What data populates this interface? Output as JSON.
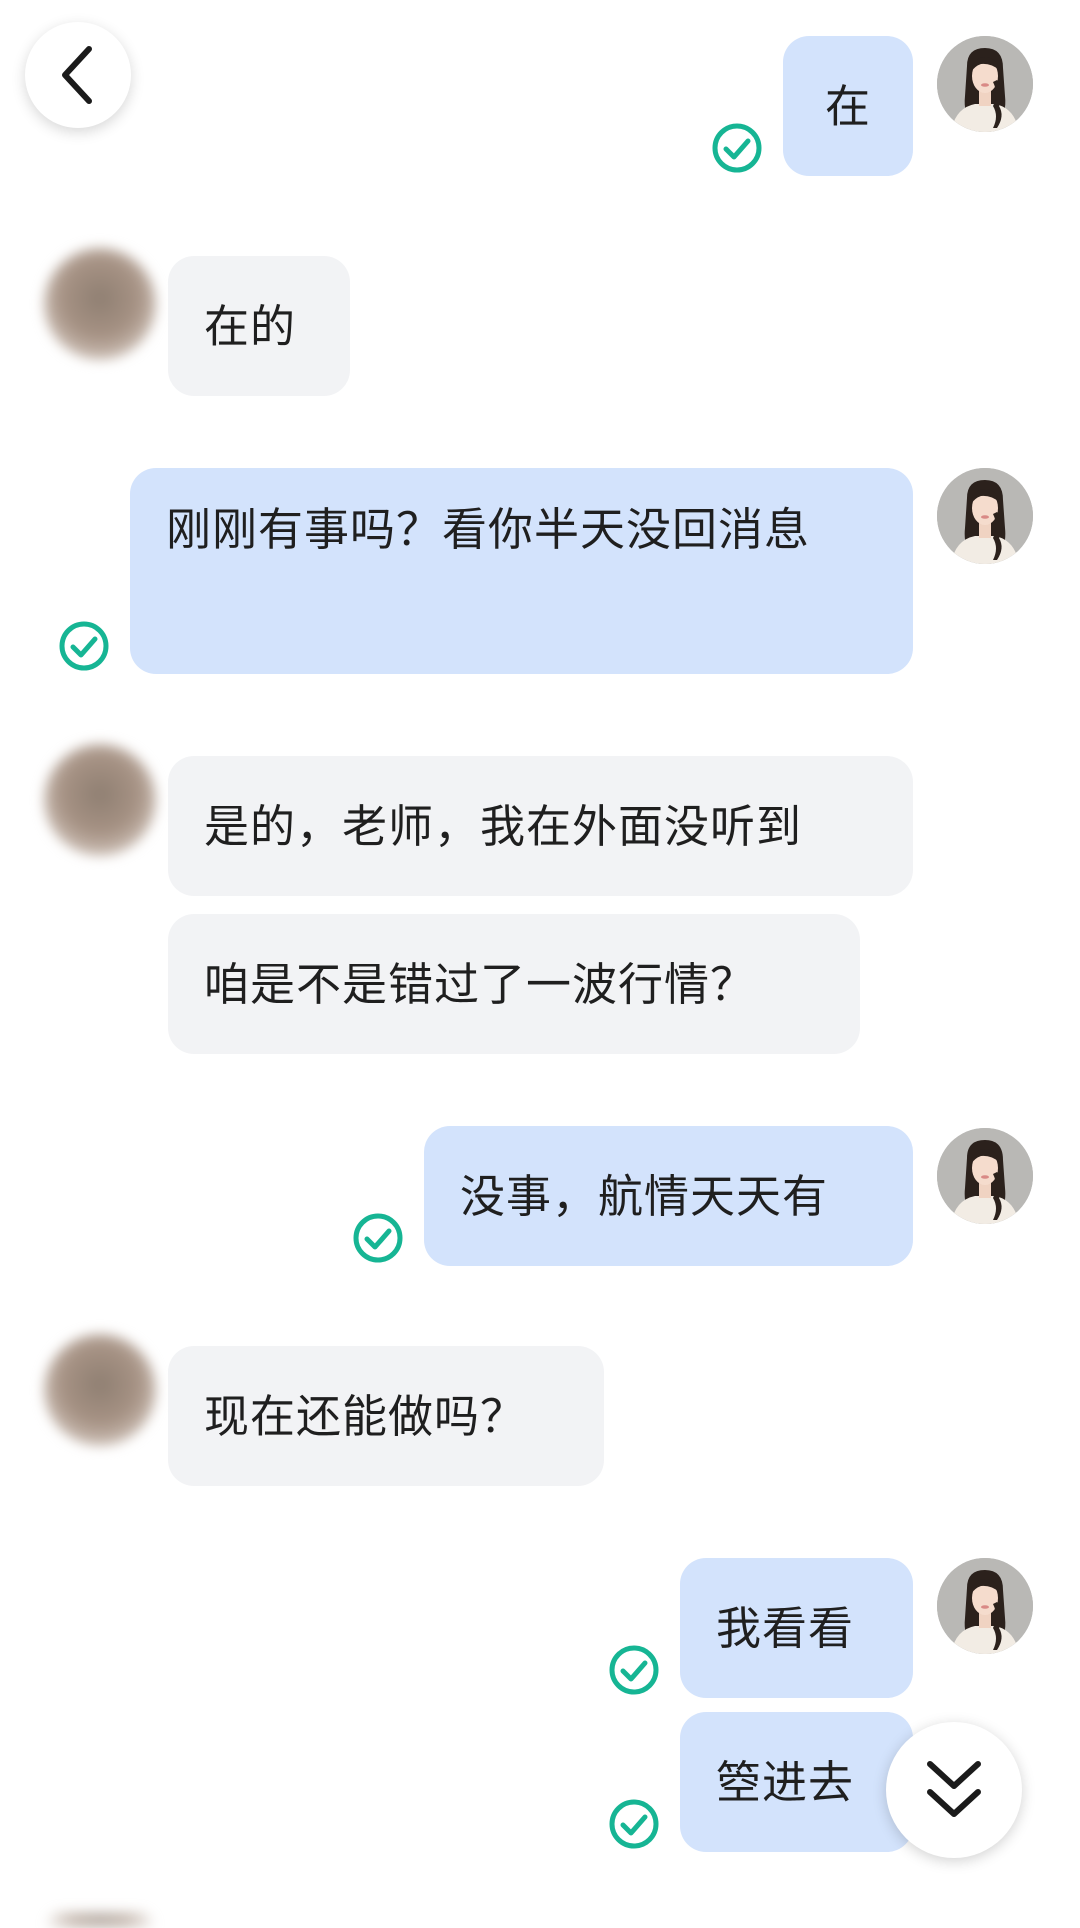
{
  "nav": {
    "back_icon": "chevron-left-icon",
    "scroll_down_icon": "double-chevron-down-icon"
  },
  "messages": [
    {
      "from": "me",
      "text": "在",
      "status": "read"
    },
    {
      "from": "peer",
      "text": "在的"
    },
    {
      "from": "me",
      "text": "刚刚有事吗？看你半天没回消息",
      "status": "read"
    },
    {
      "from": "peer",
      "text": "是的，老师，我在外面没听到"
    },
    {
      "from": "peer",
      "text": "咱是不是错过了一波行情？"
    },
    {
      "from": "me",
      "text": "没事，航情天天有",
      "status": "read"
    },
    {
      "from": "peer",
      "text": "现在还能做吗？"
    },
    {
      "from": "me",
      "text": "我看看",
      "status": "read"
    },
    {
      "from": "me",
      "text": "箜进去",
      "status": "read"
    }
  ],
  "colors": {
    "outgoing_bubble": "#d3e3fc",
    "incoming_bubble": "#f2f3f5",
    "read_check": "#16b594",
    "background": "#ffffff"
  }
}
